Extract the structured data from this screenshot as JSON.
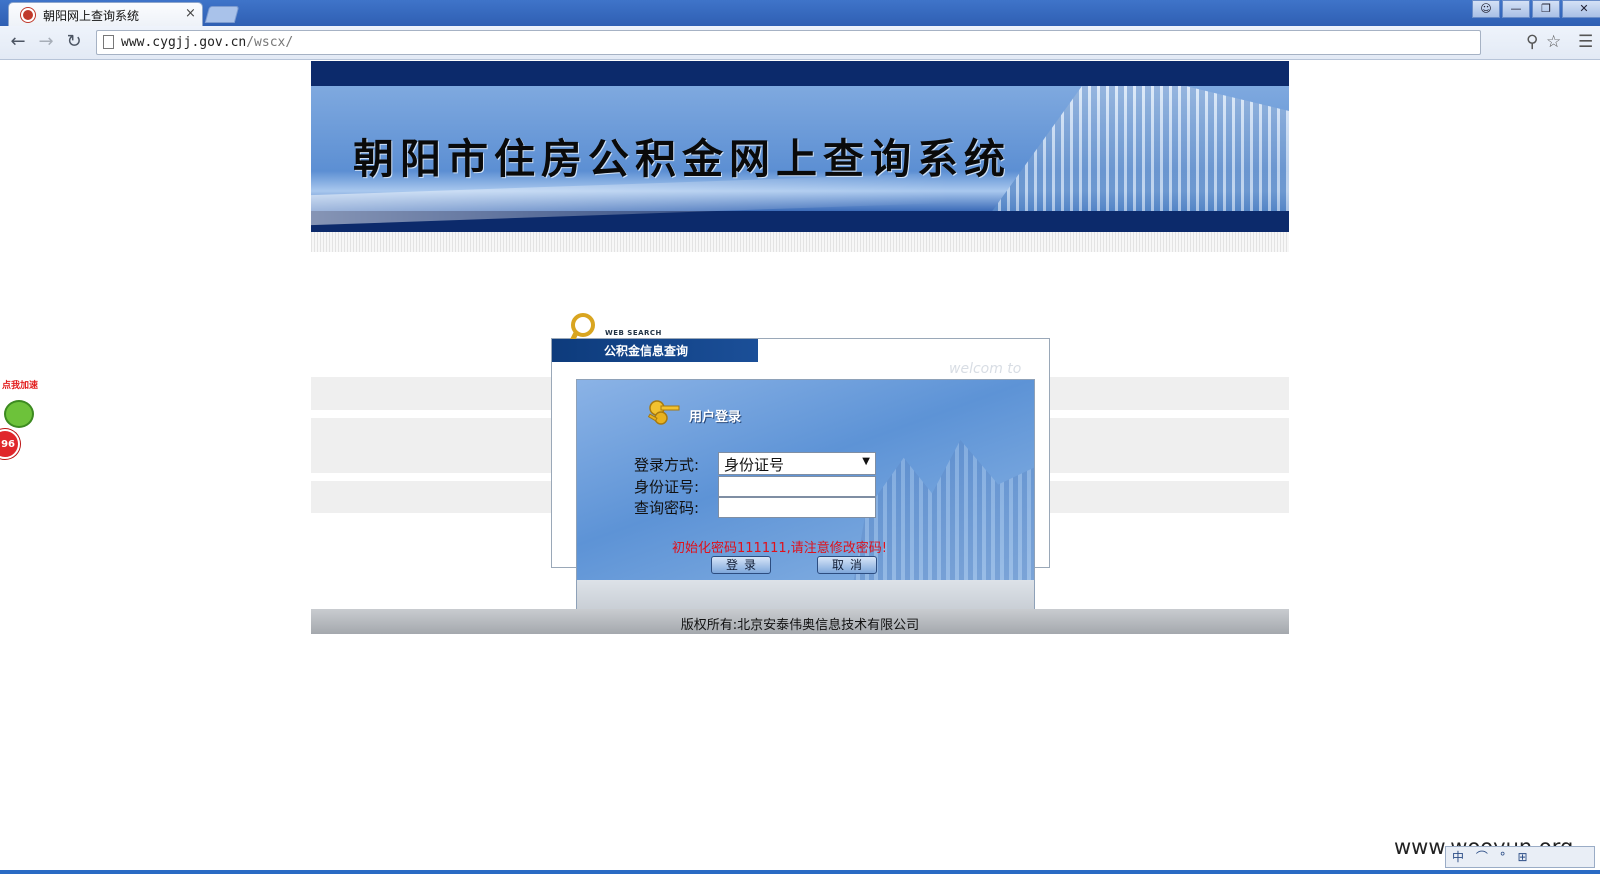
{
  "browser": {
    "tab_title": "朝阳网上查询系统",
    "tab_close": "×",
    "url_host": "www.cygjj.gov.cn",
    "url_path": "/wscx/",
    "back_icon": "arrow-left-icon",
    "forward_icon": "arrow-right-icon",
    "reload_icon": "reload-icon"
  },
  "banner": {
    "title": "朝阳市住房公积金网上查询系统"
  },
  "panel": {
    "search_label": "WEB SEARCH",
    "header": "公积金信息查询",
    "welcome": "welcom to"
  },
  "login": {
    "title": "用户登录",
    "method_label": "登录方式:",
    "method_selected": "身份证号",
    "id_label": "身份证号:",
    "password_label": "查询密码:",
    "id_value": "",
    "password_value": "",
    "notice": "初始化密码111111,请注意修改密码!",
    "login_button": "登录",
    "cancel_button": "取消"
  },
  "footer": {
    "copyright": "版权所有:北京安泰伟奥信息技术有限公司"
  },
  "widget": {
    "speed_label": "点我加速",
    "speed_badge": "96"
  },
  "watermark": "www.wooyun.org",
  "tray": "中 ⌒ ° ⊞"
}
